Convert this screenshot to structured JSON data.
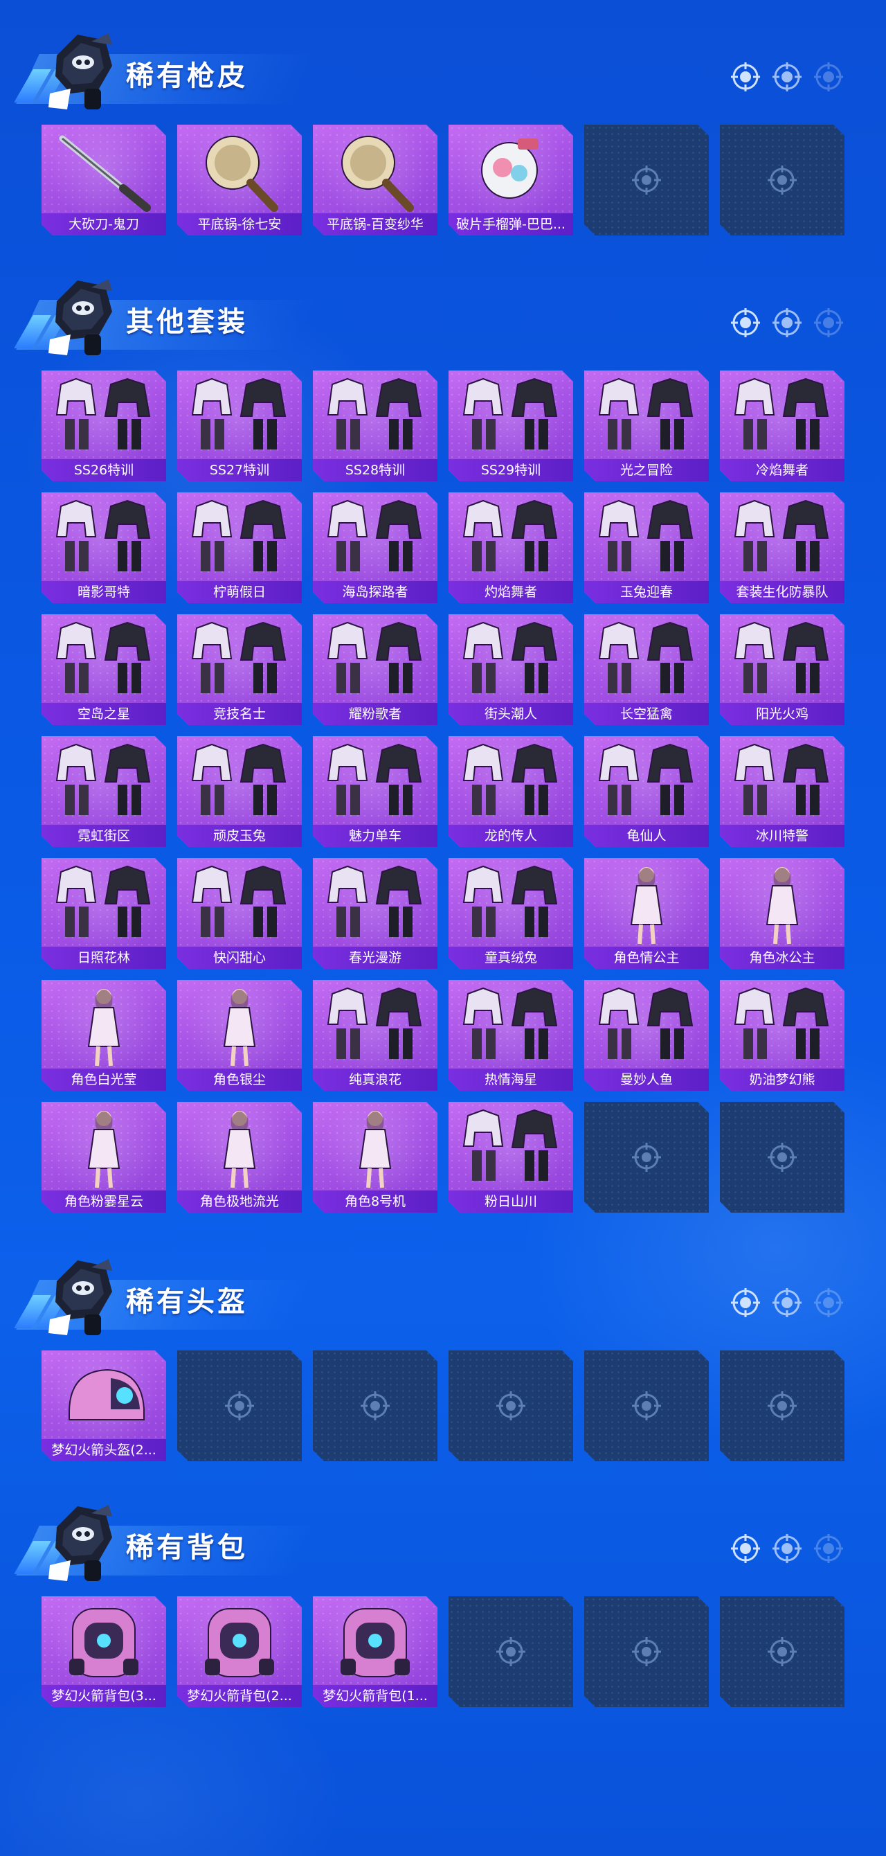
{
  "colors": {
    "background": "#0b55e0",
    "card_filled": "#a652e6",
    "card_label": "#6a26d4",
    "card_empty": "#1d3d72",
    "title_text": "#ffffff"
  },
  "sections": [
    {
      "id": "rare-gun-skins",
      "title": "稀有枪皮",
      "items": [
        {
          "label": "大砍刀-鬼刀",
          "icon": "machete-icon"
        },
        {
          "label": "平底锅-徐七安",
          "icon": "frying-pan-icon"
        },
        {
          "label": "平底锅-百变纱华",
          "icon": "frying-pan-icon"
        },
        {
          "label": "破片手榴弹-巴巴...",
          "icon": "grenade-icon"
        },
        {
          "label": "",
          "empty": true
        },
        {
          "label": "",
          "empty": true
        }
      ]
    },
    {
      "id": "other-outfits",
      "title": "其他套装",
      "items": [
        {
          "label": "SS26特训",
          "icon": "outfit-icon"
        },
        {
          "label": "SS27特训",
          "icon": "outfit-icon"
        },
        {
          "label": "SS28特训",
          "icon": "outfit-icon"
        },
        {
          "label": "SS29特训",
          "icon": "outfit-icon"
        },
        {
          "label": "光之冒险",
          "icon": "outfit-icon"
        },
        {
          "label": "冷焰舞者",
          "icon": "outfit-icon"
        },
        {
          "label": "暗影哥特",
          "icon": "outfit-icon"
        },
        {
          "label": "柠萌假日",
          "icon": "outfit-icon"
        },
        {
          "label": "海岛探路者",
          "icon": "outfit-icon"
        },
        {
          "label": "灼焰舞者",
          "icon": "outfit-icon"
        },
        {
          "label": "玉兔迎春",
          "icon": "outfit-icon"
        },
        {
          "label": "套装生化防暴队",
          "icon": "outfit-icon"
        },
        {
          "label": "空岛之星",
          "icon": "outfit-icon"
        },
        {
          "label": "竞技名士",
          "icon": "outfit-icon"
        },
        {
          "label": "耀粉歌者",
          "icon": "outfit-icon"
        },
        {
          "label": "街头潮人",
          "icon": "outfit-icon"
        },
        {
          "label": "长空猛禽",
          "icon": "outfit-icon"
        },
        {
          "label": "阳光火鸡",
          "icon": "outfit-icon"
        },
        {
          "label": "霓虹街区",
          "icon": "outfit-icon"
        },
        {
          "label": "顽皮玉兔",
          "icon": "outfit-icon"
        },
        {
          "label": "魅力单车",
          "icon": "outfit-icon"
        },
        {
          "label": "龙的传人",
          "icon": "outfit-icon"
        },
        {
          "label": "龟仙人",
          "icon": "outfit-icon"
        },
        {
          "label": "冰川特警",
          "icon": "outfit-icon"
        },
        {
          "label": "日照花林",
          "icon": "outfit-icon"
        },
        {
          "label": "快闪甜心",
          "icon": "outfit-icon"
        },
        {
          "label": "春光漫游",
          "icon": "outfit-icon"
        },
        {
          "label": "童真绒兔",
          "icon": "outfit-icon"
        },
        {
          "label": "角色情公主",
          "icon": "character-icon"
        },
        {
          "label": "角色冰公主",
          "icon": "character-icon"
        },
        {
          "label": "角色白光莹",
          "icon": "character-icon"
        },
        {
          "label": "角色银尘",
          "icon": "character-icon"
        },
        {
          "label": "纯真浪花",
          "icon": "outfit-icon"
        },
        {
          "label": "热情海星",
          "icon": "outfit-icon"
        },
        {
          "label": "曼妙人鱼",
          "icon": "outfit-icon"
        },
        {
          "label": "奶油梦幻熊",
          "icon": "outfit-icon"
        },
        {
          "label": "角色粉霎星云",
          "icon": "character-icon"
        },
        {
          "label": "角色极地流光",
          "icon": "character-icon"
        },
        {
          "label": "角色8号机",
          "icon": "character-icon"
        },
        {
          "label": "粉日山川",
          "icon": "outfit-icon"
        },
        {
          "label": "",
          "empty": true
        },
        {
          "label": "",
          "empty": true
        }
      ]
    },
    {
      "id": "rare-helmets",
      "title": "稀有头盔",
      "items": [
        {
          "label": "梦幻火箭头盔(2...",
          "icon": "helmet-icon"
        },
        {
          "label": "",
          "empty": true
        },
        {
          "label": "",
          "empty": true
        },
        {
          "label": "",
          "empty": true
        },
        {
          "label": "",
          "empty": true
        },
        {
          "label": "",
          "empty": true
        }
      ]
    },
    {
      "id": "rare-backpacks",
      "title": "稀有背包",
      "items": [
        {
          "label": "梦幻火箭背包(3...",
          "icon": "backpack-icon"
        },
        {
          "label": "梦幻火箭背包(2...",
          "icon": "backpack-icon"
        },
        {
          "label": "梦幻火箭背包(1...",
          "icon": "backpack-icon"
        },
        {
          "label": "",
          "empty": true
        },
        {
          "label": "",
          "empty": true
        },
        {
          "label": "",
          "empty": true
        }
      ]
    }
  ]
}
